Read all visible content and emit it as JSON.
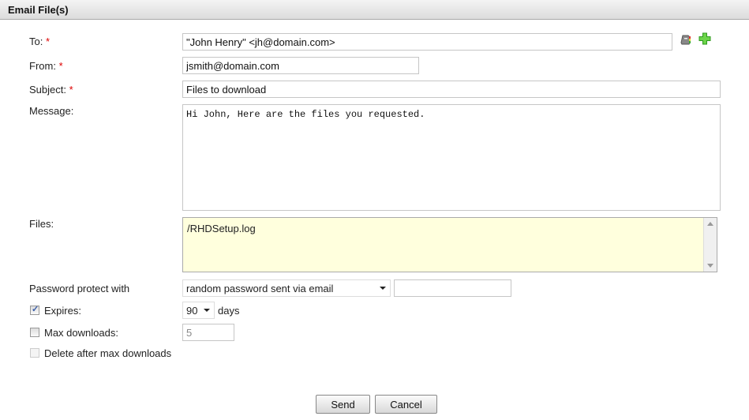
{
  "header": {
    "title": "Email File(s)"
  },
  "form": {
    "to": {
      "label": "To:",
      "required": "*",
      "value": "\"John Henry\" <jh@domain.com>"
    },
    "from": {
      "label": "From:",
      "required": "*",
      "value": "jsmith@domain.com"
    },
    "subject": {
      "label": "Subject:",
      "required": "*",
      "value": "Files to download"
    },
    "message": {
      "label": "Message:",
      "value": "Hi John, Here are the files you requested."
    },
    "files": {
      "label": "Files:",
      "items": [
        "/RHDSetup.log"
      ]
    },
    "password": {
      "label": "Password protect with",
      "selected": "random password sent via email",
      "value": ""
    },
    "expires": {
      "label": "Expires:",
      "checked": true,
      "selected": "90",
      "unit": "days"
    },
    "max_downloads": {
      "label": "Max downloads:",
      "checked": false,
      "value": "5"
    },
    "delete_after": {
      "label": "Delete after max downloads",
      "checked": false,
      "disabled": true
    }
  },
  "icons": {
    "address_book": "address-book-icon",
    "add": "plus-icon"
  },
  "buttons": {
    "send": "Send",
    "cancel": "Cancel"
  }
}
